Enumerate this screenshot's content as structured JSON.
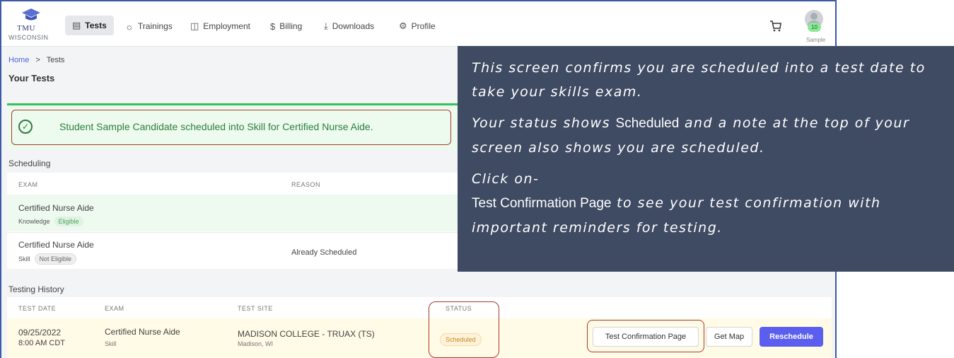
{
  "nav": {
    "logo_top": "TMU",
    "logo_bottom": "WISCONSIN",
    "items": [
      {
        "label": "Tests",
        "icon": "clipboard-icon"
      },
      {
        "label": "Trainings",
        "icon": "lightbulb-icon"
      },
      {
        "label": "Employment",
        "icon": "briefcase-icon"
      },
      {
        "label": "Billing",
        "icon": "dollar-icon"
      },
      {
        "label": "Downloads",
        "icon": "download-icon"
      },
      {
        "label": "Profile",
        "icon": "gear-icon"
      }
    ],
    "cart_icon": "cart-icon",
    "avatar_badge": "10",
    "avatar_name": "Sample"
  },
  "breadcrumb": {
    "home": "Home",
    "separator": ">",
    "current": "Tests"
  },
  "page_title": "Your Tests",
  "alert": {
    "message": "Student Sample Candidate scheduled into Skill for Certified Nurse Aide."
  },
  "scheduling": {
    "title": "Scheduling",
    "headers": {
      "exam": "EXAM",
      "reason": "REASON"
    },
    "rows": [
      {
        "exam": "Certified Nurse Aide",
        "type": "Knowledge",
        "eligibility": "Eligible",
        "reason": ""
      },
      {
        "exam": "Certified Nurse Aide",
        "type": "Skill",
        "eligibility": "Not Eligible",
        "reason": "Already Scheduled"
      }
    ]
  },
  "history": {
    "title": "Testing History",
    "headers": {
      "date": "TEST DATE",
      "exam": "EXAM",
      "site": "TEST SITE",
      "status": "STATUS"
    },
    "row": {
      "date": "09/25/2022",
      "time": "8:00 AM CDT",
      "exam": "Certified Nurse Aide",
      "exam_type": "Skill",
      "site": "MADISON COLLEGE - TRUAX (TS)",
      "site_city": "Madison, WI",
      "status": "Scheduled",
      "actions": {
        "confirmation": "Test Confirmation Page",
        "map": "Get Map",
        "reschedule": "Reschedule"
      }
    }
  },
  "overlay": {
    "p1": "This screen confirms you are scheduled into a test date to take your skills exam.",
    "p2_a": "Your status shows",
    "p2_strong": "Scheduled",
    "p2_b": "and a note at the top of your screen also shows you are scheduled.",
    "p3_a": "Click on-",
    "p3_strong": "Test Confirmation Page",
    "p3_b": "to see your test confirmation with important reminders for testing."
  },
  "colors": {
    "accent": "#5b5ff0",
    "success": "#2f7d3d",
    "overlay_bg": "#3f4b63",
    "frame": "#3a5aa8",
    "annotation": "#a63a2a"
  }
}
